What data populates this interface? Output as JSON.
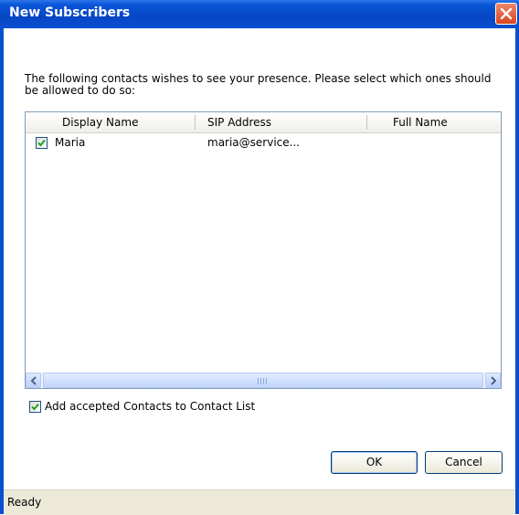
{
  "window": {
    "title": "New Subscribers"
  },
  "intro_text": "The following contacts wishes to see your presence. Please select which ones should be allowed to do so:",
  "list": {
    "columns": [
      "Display Name",
      "SIP Address",
      "Full Name"
    ],
    "rows": [
      {
        "checked": true,
        "display_name": "Maria",
        "sip_address": "maria@service...",
        "full_name": ""
      }
    ]
  },
  "add_to_contacts": {
    "checked": true,
    "label": "Add accepted Contacts to Contact List"
  },
  "buttons": {
    "ok": "OK",
    "cancel": "Cancel"
  },
  "status": "Ready",
  "colors": {
    "titlebar": "#0a4fd0",
    "close": "#d9451f",
    "face": "#ece9d8"
  }
}
